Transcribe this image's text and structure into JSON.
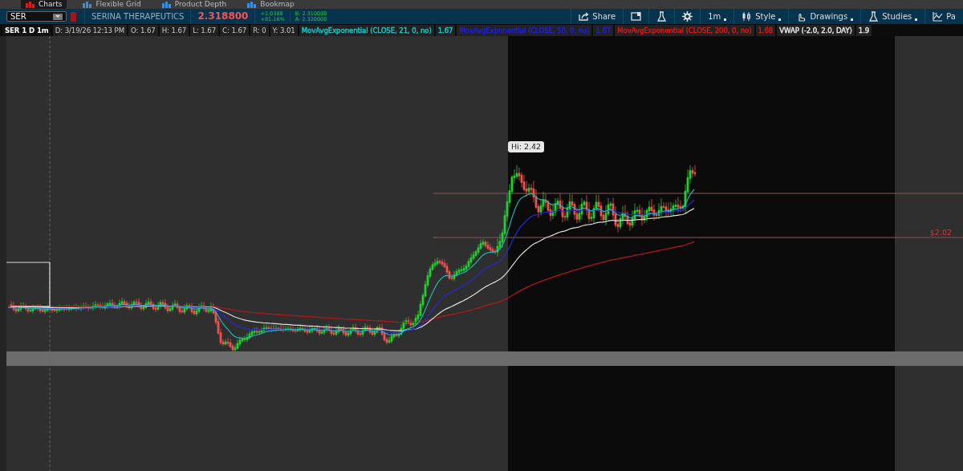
{
  "top_tabs": [
    {
      "label": "Charts",
      "selected": true
    },
    {
      "label": "Flexible Grid",
      "selected": false
    },
    {
      "label": "Product Depth",
      "selected": false
    },
    {
      "label": "Bookmap",
      "selected": false
    }
  ],
  "header": {
    "symbol": "SER",
    "company": "SERINA THERAPEUTICS",
    "last": "2.318800",
    "change": "+1.0388",
    "change_pct": "+81.16%",
    "bid": "B: 2.310000",
    "ask": "A: 2.320000"
  },
  "toolbar": [
    {
      "kind": "share",
      "label": "Share"
    },
    {
      "kind": "notes"
    },
    {
      "kind": "flask"
    },
    {
      "kind": "gear"
    },
    {
      "kind": "aggregation",
      "label": "1m"
    },
    {
      "kind": "style",
      "label": "Style"
    },
    {
      "kind": "drawings",
      "label": "Drawings"
    },
    {
      "kind": "studies",
      "label": "Studies"
    },
    {
      "kind": "pattern",
      "label": "Pa"
    }
  ],
  "legend": [
    {
      "kind": "title",
      "text": "SER 1 D 1m"
    },
    {
      "kind": "field",
      "text": "D: 3/19/26 12:13 PM"
    },
    {
      "kind": "field",
      "text": "O: 1.67"
    },
    {
      "kind": "field",
      "text": "H: 1.67"
    },
    {
      "kind": "field",
      "text": "L: 1.67"
    },
    {
      "kind": "field",
      "text": "C: 1.67"
    },
    {
      "kind": "field",
      "text": "R: 0"
    },
    {
      "kind": "field",
      "text": "Y: 3.01"
    },
    {
      "kind": "study",
      "text": "MovAvgExponential (CLOSE, 21, 0, no)",
      "color": "#1ec8c8"
    },
    {
      "kind": "study",
      "text": "1.67",
      "color": "#1ec8c8"
    },
    {
      "kind": "study",
      "text": "MovAvgExponential (CLOSE, 50, 0, no)",
      "color": "#2020d8"
    },
    {
      "kind": "study",
      "text": "1.67",
      "color": "#2020d8"
    },
    {
      "kind": "study",
      "text": "MovAvgExponential (CLOSE, 200, 0, no)",
      "color": "#e01818"
    },
    {
      "kind": "study",
      "text": "1.68",
      "color": "#e01818"
    },
    {
      "kind": "study",
      "text": "VWAP (-2.0, 2.0, DAY)",
      "color": "#e8e8e8"
    },
    {
      "kind": "study",
      "text": "1.9",
      "color": "#e8e8e8"
    }
  ],
  "chart": {
    "hi_label": "Hi: 2.42",
    "price_label": "$2.02"
  }
}
